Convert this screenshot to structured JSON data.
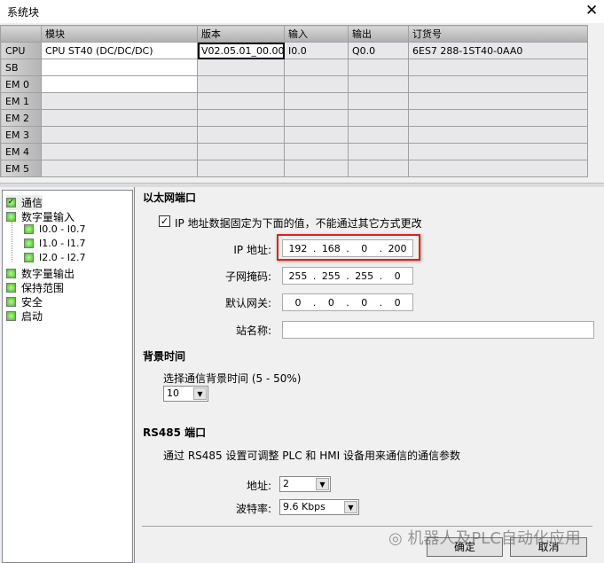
{
  "window": {
    "title": "系统块",
    "close_icon": "close-icon"
  },
  "grid": {
    "headers": [
      "",
      "模块",
      "版本",
      "输入",
      "输出",
      "订货号"
    ],
    "rows": [
      {
        "slot": "CPU",
        "module": "CPU ST40 (DC/DC/DC)",
        "version": "V02.05.01_00.00...",
        "input": "I0.0",
        "output": "Q0.0",
        "order": "6ES7 288-1ST40-0AA0"
      },
      {
        "slot": "SB",
        "module": "",
        "version": "",
        "input": "",
        "output": "",
        "order": ""
      },
      {
        "slot": "EM 0",
        "module": "",
        "version": "",
        "input": "",
        "output": "",
        "order": ""
      },
      {
        "slot": "EM 1",
        "module": "",
        "version": "",
        "input": "",
        "output": "",
        "order": ""
      },
      {
        "slot": "EM 2",
        "module": "",
        "version": "",
        "input": "",
        "output": "",
        "order": ""
      },
      {
        "slot": "EM 3",
        "module": "",
        "version": "",
        "input": "",
        "output": "",
        "order": ""
      },
      {
        "slot": "EM 4",
        "module": "",
        "version": "",
        "input": "",
        "output": "",
        "order": ""
      },
      {
        "slot": "EM 5",
        "module": "",
        "version": "",
        "input": "",
        "output": "",
        "order": ""
      }
    ]
  },
  "tree": [
    "通信",
    "数字量输入",
    "I0.0 - I0.7",
    "I1.0 - I1.7",
    "I2.0 - I2.7",
    "数字量输出",
    "保持范围",
    "安全",
    "启动"
  ],
  "ethernet": {
    "title": "以太网端口",
    "fixed_ip_label": "IP 地址数据固定为下面的值，不能通过其它方式更改",
    "fixed_ip_checked": true,
    "ip_label": "IP 地址:",
    "ip": [
      "192",
      "168",
      "0",
      "200"
    ],
    "mask_label": "子网掩码:",
    "mask": [
      "255",
      "255",
      "255",
      "0"
    ],
    "gateway_label": "默认网关:",
    "gateway": [
      "0",
      "0",
      "0",
      "0"
    ],
    "station_label": "站名称:",
    "station": ""
  },
  "background": {
    "title": "背景时间",
    "label": "选择通信背景时间 (5 - 50%)",
    "value": "10"
  },
  "rs485": {
    "title": "RS485 端口",
    "desc": "通过 RS485 设置可调整 PLC 和 HMI 设备用来通信的通信参数",
    "address_label": "地址:",
    "address": "2",
    "baud_label": "波特率:",
    "baud": "9.6 Kbps"
  },
  "buttons": {
    "ok": "确定",
    "cancel": "取消"
  },
  "watermark": "机器人及PLC自动化应用",
  "colors": {
    "highlight": "#e02020"
  }
}
